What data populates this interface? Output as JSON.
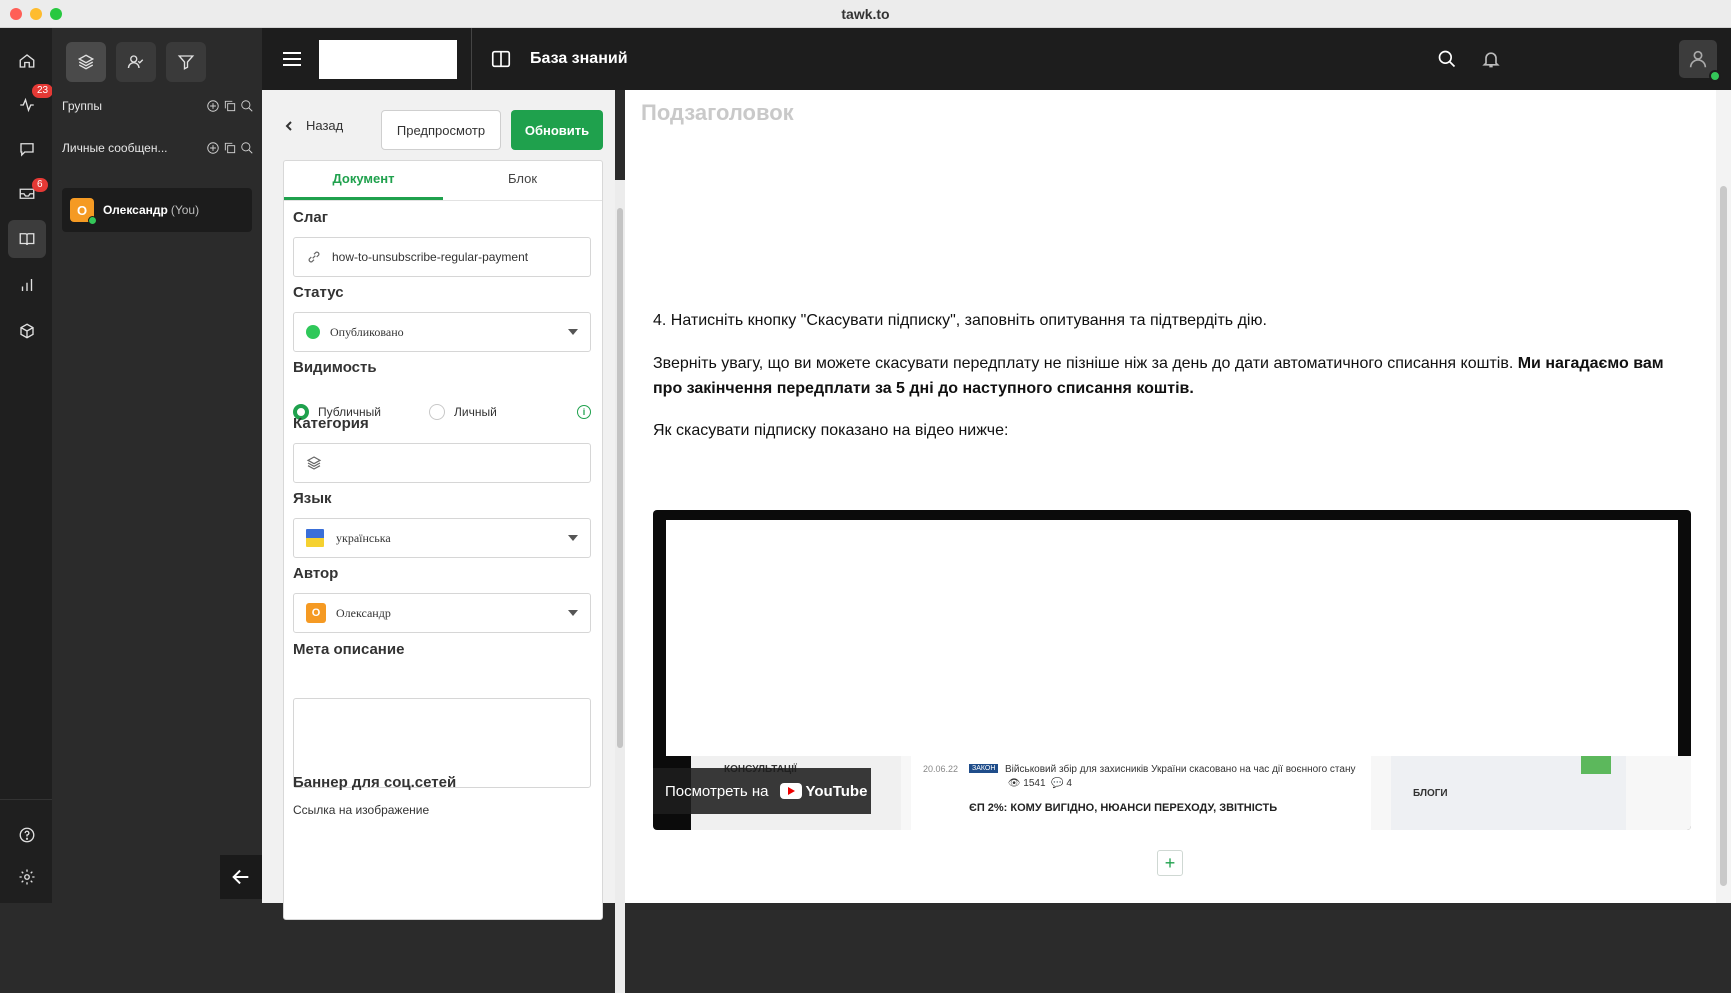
{
  "window": {
    "title": "tawk.to"
  },
  "rail": {
    "items": [
      {
        "name": "home",
        "icon": "home-icon"
      },
      {
        "name": "activity",
        "icon": "activity-icon",
        "badge": "23"
      },
      {
        "name": "chat",
        "icon": "chat-icon"
      },
      {
        "name": "inbox",
        "icon": "inbox-icon",
        "badge": "6"
      },
      {
        "name": "knowledge-base",
        "icon": "book-icon",
        "active": true
      },
      {
        "name": "reports",
        "icon": "bar-chart-icon"
      },
      {
        "name": "addons",
        "icon": "cube-icon"
      },
      {
        "name": "help",
        "icon": "help-icon"
      },
      {
        "name": "settings",
        "icon": "gear-icon"
      }
    ]
  },
  "sidebar": {
    "groups_label": "Группы",
    "dm_label": "Личные сообщен...",
    "user": {
      "initial": "O",
      "name": "Олександр",
      "suffix": "(You)"
    }
  },
  "header": {
    "title": "База знаний"
  },
  "panel": {
    "back_label": "Назад",
    "preview_label": "Предпросмотр",
    "update_label": "Обновить",
    "tabs": [
      "Документ",
      "Блок"
    ],
    "slug": {
      "label": "Слаг",
      "value": "how-to-unsubscribe-regular-payment"
    },
    "status": {
      "label": "Статус",
      "value": "Опубликовано"
    },
    "visibility": {
      "label": "Видимость",
      "public": "Публичный",
      "private": "Личный"
    },
    "category": {
      "label": "Категория"
    },
    "language": {
      "label": "Язык",
      "value": "українська"
    },
    "author": {
      "label": "Автор",
      "initial": "O",
      "value": "Олександр"
    },
    "meta": {
      "label": "Мета описание"
    },
    "social": {
      "label": "Баннер для соц.сетей",
      "image_link_label": "Ссылка на изображение"
    }
  },
  "content": {
    "subheading": "Подзаголовок",
    "step4": "4. Натисніть кнопку \"Скасувати підписку\", заповніть опитування та підтвердіть дію.",
    "note_regular": "Зверніть увагу, що ви можете скасувати передплату не пізніше ніж за день до дати автоматичного списання коштів. ",
    "note_bold": "Ми нагадаємо вам про закінчення передплати за 5 дні до наступного списання коштів.",
    "video_intro": "Як скасувати підписку показано на відео нижче:",
    "video": {
      "watch_label": "Посмотреть на",
      "youtube_label": "YouTube",
      "consult": "КОНСУЛЬТАЦІЇ",
      "date": "20.06.22",
      "tag": "ЗАКОН",
      "news": "Військовий збір для захисників України скасовано на час дії воєнного стану",
      "views": "1541",
      "comments": "4",
      "headline": "ЄП 2%: КОМУ ВИГІДНО, НЮАНСИ ПЕРЕХОДУ, ЗВІТНІСТЬ",
      "blogs": "БЛОГИ"
    },
    "add_block": "+"
  }
}
